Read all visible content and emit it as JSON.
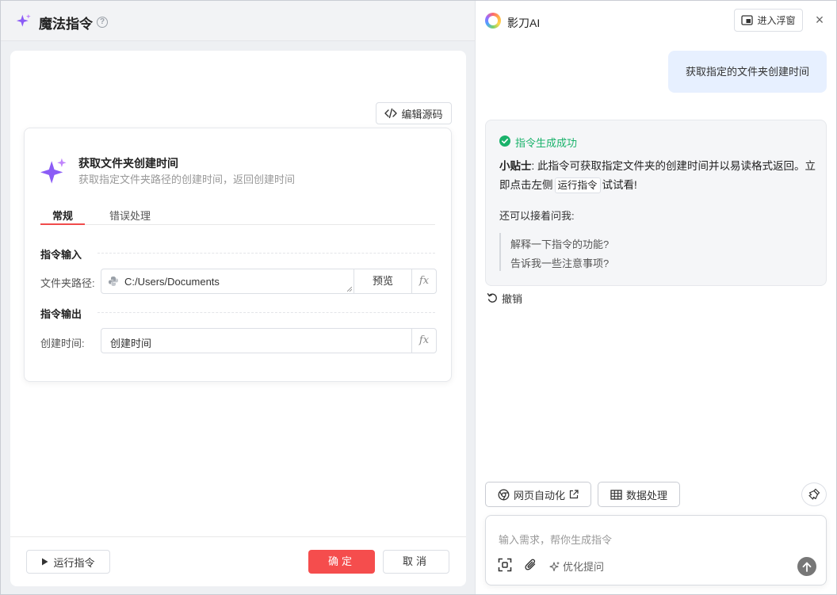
{
  "left": {
    "title": "魔法指令",
    "help_glyph": "?",
    "source_button": "编辑源码",
    "command": {
      "title": "获取文件夹创建时间",
      "description": "获取指定文件夹路径的创建时间，返回创建时间"
    },
    "tabs": [
      {
        "label": "常规",
        "active": true
      },
      {
        "label": "错误处理",
        "active": false
      }
    ],
    "input_section": "指令输入",
    "output_section": "指令输出",
    "folder_label": "文件夹路径:",
    "folder_value": "C:/Users/Documents",
    "preview_button": "预览",
    "fx_label": "fx",
    "created_label": "创建时间:",
    "created_value": "创建时间",
    "run_button": "运行指令",
    "ok_button": "确定",
    "cancel_button": "取消"
  },
  "right": {
    "app_name": "影刀AI",
    "float_button": "进入浮窗",
    "close_glyph": "×",
    "user_message": "获取指定的文件夹创建时间",
    "status": "指令生成成功",
    "tip_label": "小贴士",
    "tip_text": ": 此指令可获取指定文件夹的创建时间并以易读格式返回。立即点击左侧",
    "tip_tag": "运行指令",
    "tip_end": "试试看!",
    "ask_more": "还可以接着问我:",
    "questions": [
      "解释一下指令的功能?",
      "告诉我一些注意事项?"
    ],
    "undo": "撤销",
    "chips": [
      "网页自动化",
      "数据处理"
    ],
    "input_placeholder": "输入需求，帮你生成指令",
    "optimize": "优化提问"
  },
  "colors": {
    "accent_red": "#f54d4d",
    "success_green": "#1ab26b",
    "user_bubble": "#e7f0ff",
    "sparkle": "#8b5cf6"
  }
}
